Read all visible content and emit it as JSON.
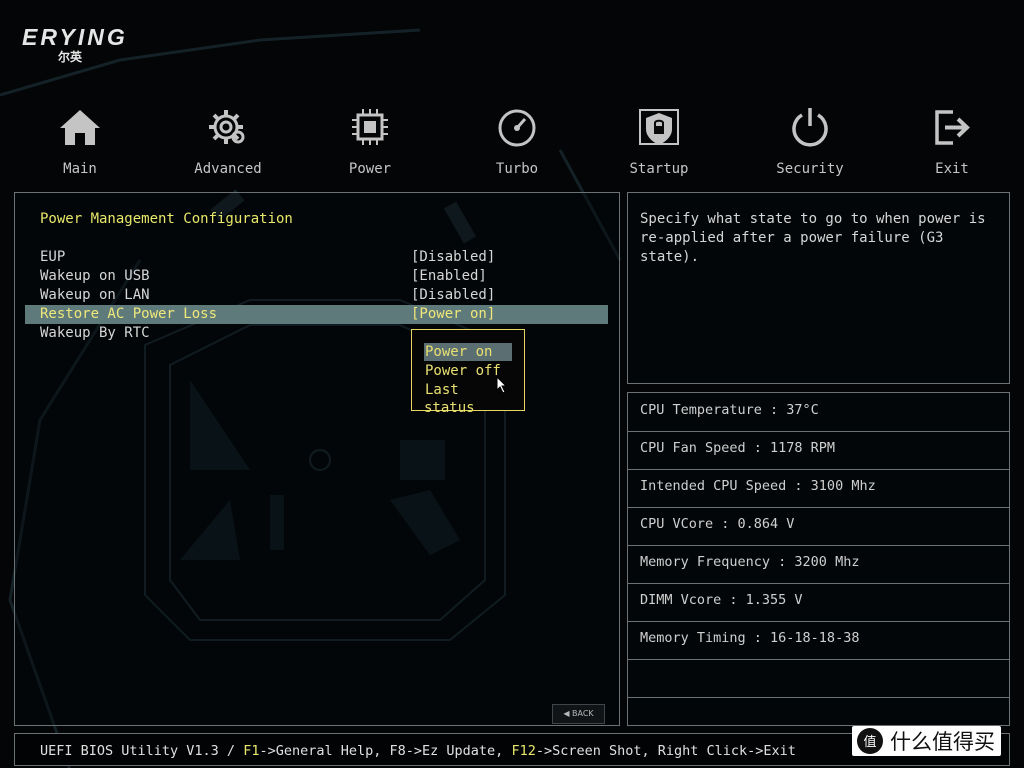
{
  "brand": {
    "name": "ERYING",
    "subtitle": "尔英",
    "bg_watermark": "ERYING"
  },
  "nav": [
    {
      "label": "Main",
      "icon": "home-icon"
    },
    {
      "label": "Advanced",
      "icon": "gear-icon"
    },
    {
      "label": "Power",
      "icon": "cpu-chip-icon"
    },
    {
      "label": "Turbo",
      "icon": "gauge-icon"
    },
    {
      "label": "Startup",
      "icon": "shield-icon"
    },
    {
      "label": "Security",
      "icon": "power-icon"
    },
    {
      "label": "Exit",
      "icon": "exit-icon"
    }
  ],
  "section_title": "Power Management Configuration",
  "settings": [
    {
      "label": "EUP",
      "value": "[Disabled]"
    },
    {
      "label": "Wakeup on USB",
      "value": "[Enabled]"
    },
    {
      "label": "Wakeup on LAN",
      "value": "[Disabled]"
    },
    {
      "label": "Restore AC Power Loss",
      "value": "[Power on]",
      "selected": true
    },
    {
      "label": "Wakeup By RTC",
      "value": ""
    }
  ],
  "popup": {
    "options": [
      "Power on",
      "Power off",
      "Last status"
    ],
    "active_index": 0
  },
  "back_button": "BACK",
  "help_text": "Specify what state to go to when power is re-applied after a power failure (G3 state).",
  "system_info": [
    "CPU Temperature : 37°C",
    "CPU Fan Speed : 1178 RPM",
    "Intended CPU Speed : 3100 Mhz",
    "CPU VCore : 0.864 V",
    "Memory Frequency : 3200 Mhz",
    "DIMM Vcore : 1.355 V",
    "Memory Timing : 16-18-18-38",
    ""
  ],
  "footer": {
    "prefix": "UEFI BIOS Utility V1.3 / ",
    "k1": "F1",
    "t1": "->General Help, F8->Ez Update, ",
    "k2": "F12",
    "t2": "->Screen Shot, Right Click->Exit"
  },
  "watermark": {
    "text": "什么值得买",
    "badge": "值"
  },
  "colors": {
    "accent_yellow": "#e8e86a",
    "selection_bg": "#5f7a7a",
    "panel_border": "#6a7276",
    "background": "#030506"
  }
}
